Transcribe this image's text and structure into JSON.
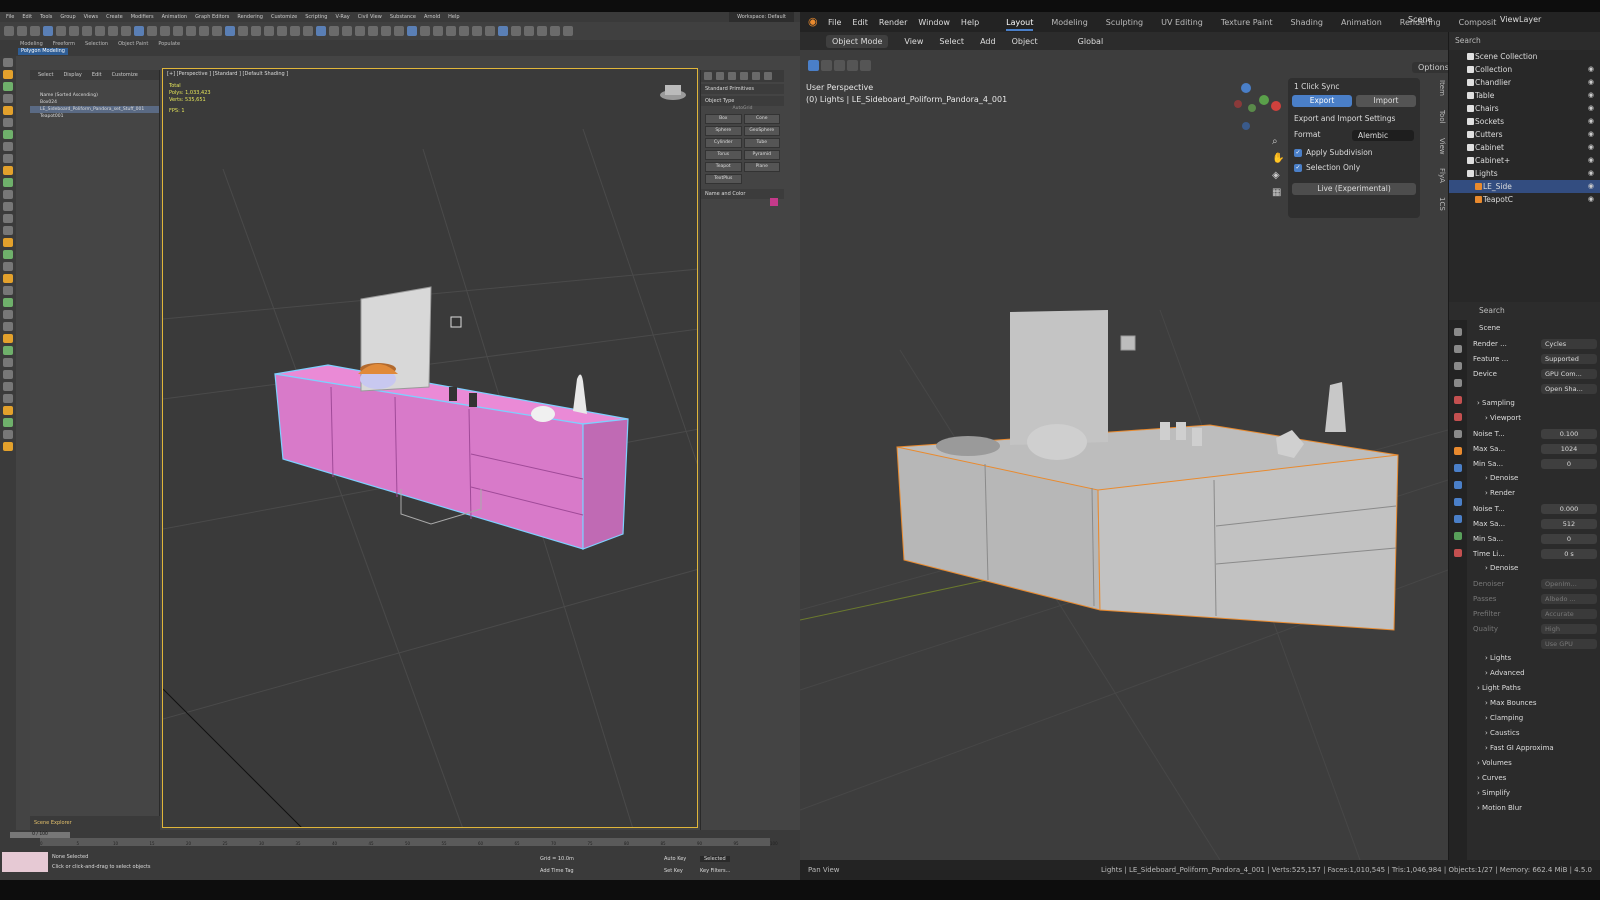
{
  "max": {
    "menu": [
      "File",
      "Edit",
      "Tools",
      "Group",
      "Views",
      "Create",
      "Modifiers",
      "Animation",
      "Graph Editors",
      "Rendering",
      "Customize",
      "Scripting",
      "V-Ray",
      "Civil View",
      "Substance",
      "Arnold",
      "Help"
    ],
    "workspace": "Workspace: Default",
    "ribbon_tabs": [
      "Modeling",
      "Freeform",
      "Selection",
      "Object Paint",
      "Populate"
    ],
    "ribbon_sub": "Polygon Modeling",
    "explorer_tabs": [
      "Select",
      "Display",
      "Edit",
      "Customize"
    ],
    "explorer_rows": [
      "Name (Sorted Ascending)",
      "Box024",
      "LE_Sideboard_Poliform_Pandora_set_Stuff_001",
      "Teapot001"
    ],
    "explorer_footer": "Scene Explorer",
    "viewport_label": "[+] [Perspective ] [Standard ] [Default Shading ]",
    "stats": {
      "title": "Total",
      "polys": "Polys: 1,033,423",
      "verts": "Verts: 535,651",
      "fps": "FPS: 1"
    },
    "cmd": {
      "dropdown": "Standard Primitives",
      "section1": "Object Type",
      "autogrid": "AutoGrid",
      "objects": [
        "Box",
        "Cone",
        "Sphere",
        "GeoSphere",
        "Cylinder",
        "Tube",
        "Torus",
        "Pyramid",
        "Teapot",
        "Plane",
        "TextPlus"
      ],
      "section2": "Name and Color"
    },
    "timeline_thumb": "0 / 100",
    "ticks": [
      "0",
      "5",
      "10",
      "15",
      "20",
      "25",
      "30",
      "35",
      "40",
      "45",
      "50",
      "55",
      "60",
      "65",
      "70",
      "75",
      "80",
      "85",
      "90",
      "95",
      "100"
    ],
    "status_line1": "None Selected",
    "status_line2": "Click or click-and-drag to select objects",
    "grid": "Grid = 10.0m",
    "add_time_tag": "Add Time Tag",
    "auto_key": "Auto Key",
    "set_key": "Set Key",
    "selected": "Selected",
    "key_filters": "Key Filters..."
  },
  "blender": {
    "menu": [
      "File",
      "Edit",
      "Render",
      "Window",
      "Help"
    ],
    "workspaces": [
      "Layout",
      "Modeling",
      "Sculpting",
      "UV Editing",
      "Texture Paint",
      "Shading",
      "Animation",
      "Rendering",
      "Composit"
    ],
    "active_workspace": "Layout",
    "scene": "Scene",
    "viewlayer": "ViewLayer",
    "viewport_header": {
      "mode": "Object Mode",
      "view": "View",
      "select": "Select",
      "add": "Add",
      "object": "Object",
      "orientation": "Global"
    },
    "options": "Options",
    "perspective": "User Perspective",
    "active_object": "(0) Lights | LE_Sideboard_Poliform_Pandora_4_001",
    "sync_panel": {
      "title": "1 Click Sync",
      "export": "Export",
      "import": "Import",
      "settings_label": "Export and Import Settings",
      "format_label": "Format",
      "format_value": "Alembic",
      "apply_subdivision": "Apply Subdivision",
      "selection_only": "Selection Only",
      "live": "Live (Experimental)"
    },
    "n_tabs": [
      "Item",
      "Tool",
      "View",
      "FlyA",
      "1CS"
    ],
    "outliner": {
      "search": "Search",
      "rows": [
        {
          "label": "Scene Collection",
          "child": false,
          "sel": false
        },
        {
          "label": "Collection",
          "child": false,
          "sel": false
        },
        {
          "label": "Chandlier",
          "child": false,
          "sel": false
        },
        {
          "label": "Table",
          "child": false,
          "sel": false
        },
        {
          "label": "Chairs",
          "child": false,
          "sel": false
        },
        {
          "label": "Sockets",
          "child": false,
          "sel": false
        },
        {
          "label": "Cutters",
          "child": false,
          "sel": false
        },
        {
          "label": "Cabinet",
          "child": false,
          "sel": false
        },
        {
          "label": "Cabinet+",
          "child": false,
          "sel": false
        },
        {
          "label": "Lights",
          "child": false,
          "sel": false
        },
        {
          "label": "LE_Side",
          "child": true,
          "sel": true
        },
        {
          "label": "TeapotC",
          "child": true,
          "sel": false
        }
      ]
    },
    "properties": {
      "search": "Search",
      "scene_label": "Scene",
      "rows": [
        {
          "k": "Render ...",
          "v": "Cycles",
          "t": "kv"
        },
        {
          "k": "Feature ...",
          "v": "Supported",
          "t": "kv"
        },
        {
          "k": "Device",
          "v": "GPU Com...",
          "t": "kv"
        },
        {
          "k": "",
          "v": "Open Sha...",
          "t": "kv"
        },
        {
          "k": "Sampling",
          "v": "",
          "t": "sec"
        },
        {
          "k": "Viewport",
          "v": "",
          "t": "sub"
        },
        {
          "k": "Noise T...",
          "v": "0.100",
          "t": "num"
        },
        {
          "k": "Max Sa...",
          "v": "1024",
          "t": "num"
        },
        {
          "k": "Min Sa...",
          "v": "0",
          "t": "num"
        },
        {
          "k": "Denoise",
          "v": "",
          "t": "sub"
        },
        {
          "k": "Render",
          "v": "",
          "t": "sub"
        },
        {
          "k": "Noise T...",
          "v": "0.000",
          "t": "num"
        },
        {
          "k": "Max Sa...",
          "v": "512",
          "t": "num"
        },
        {
          "k": "Min Sa...",
          "v": "0",
          "t": "num"
        },
        {
          "k": "Time Li...",
          "v": "0 s",
          "t": "num"
        },
        {
          "k": "Denoise",
          "v": "",
          "t": "sub"
        },
        {
          "k": "Denoiser",
          "v": "OpenIm...",
          "t": "dim"
        },
        {
          "k": "Passes",
          "v": "Albedo ...",
          "t": "dim"
        },
        {
          "k": "Prefilter",
          "v": "Accurate",
          "t": "dim"
        },
        {
          "k": "Quality",
          "v": "High",
          "t": "dim"
        },
        {
          "k": "",
          "v": "Use GPU",
          "t": "dim"
        },
        {
          "k": "Lights",
          "v": "",
          "t": "sub"
        },
        {
          "k": "Advanced",
          "v": "",
          "t": "sub"
        },
        {
          "k": "Light Paths",
          "v": "",
          "t": "sec"
        },
        {
          "k": "Max Bounces",
          "v": "",
          "t": "sub"
        },
        {
          "k": "Clamping",
          "v": "",
          "t": "sub"
        },
        {
          "k": "Caustics",
          "v": "",
          "t": "sub"
        },
        {
          "k": "Fast GI Approxima",
          "v": "",
          "t": "sub"
        },
        {
          "k": "Volumes",
          "v": "",
          "t": "sec"
        },
        {
          "k": "Curves",
          "v": "",
          "t": "sec"
        },
        {
          "k": "Simplify",
          "v": "",
          "t": "sec"
        },
        {
          "k": "Motion Blur",
          "v": "",
          "t": "sec"
        }
      ]
    },
    "status_left": "Pan View",
    "status_right": "Lights | LE_Sideboard_Poliform_Pandora_4_001 | Verts:525,157 | Faces:1,010,545 | Tris:1,046,984 | Objects:1/27 | Memory: 662.4 MiB | 4.5.0",
    "colors": {
      "accent": "#4a7fc8",
      "selection": "#e98a2e",
      "max_select": "#ea8ad6"
    }
  }
}
